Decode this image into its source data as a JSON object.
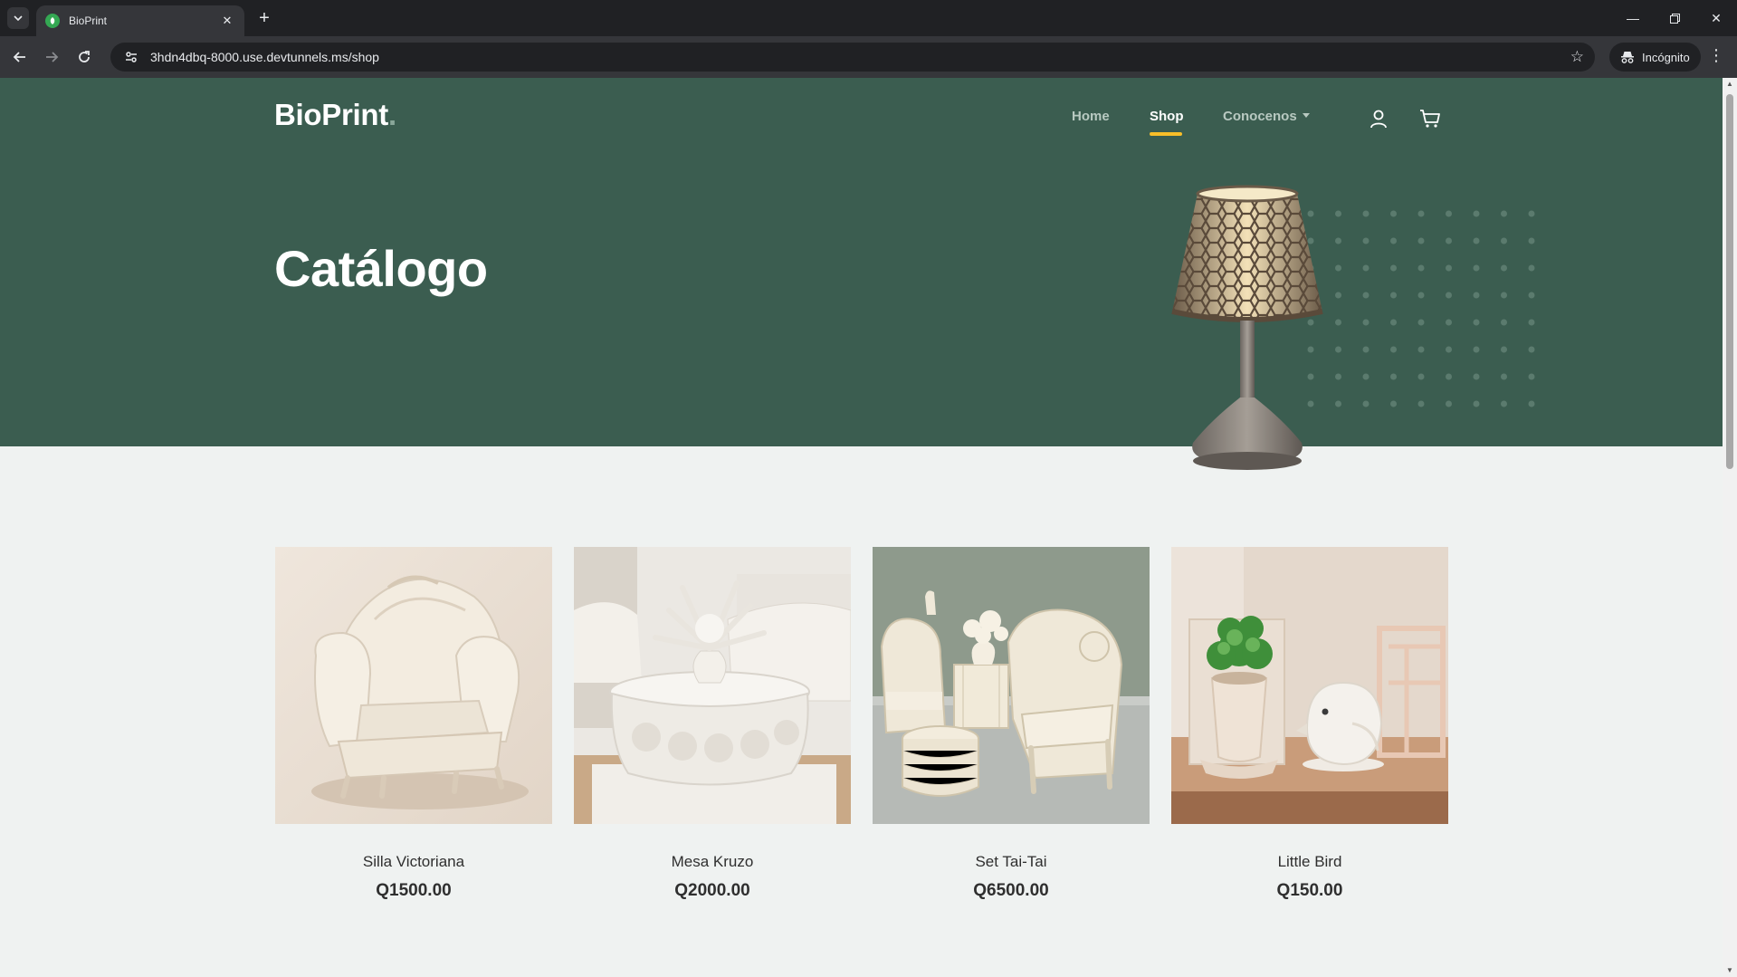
{
  "browser": {
    "tab_title": "BioPrint",
    "url": "3hdn4dbq-8000.use.devtunnels.ms/shop",
    "profile_label": "Incógnito"
  },
  "site": {
    "logo": "BioPrint",
    "logo_dot": ".",
    "nav": {
      "home": "Home",
      "shop": "Shop",
      "about": "Conocenos"
    },
    "hero_title": "Catálogo",
    "colors": {
      "hero_bg": "#3b5d50",
      "accent": "#f9bf29",
      "page_bg": "#eff2f1"
    }
  },
  "products": [
    {
      "name": "Silla Victoriana",
      "price": "Q1500.00"
    },
    {
      "name": "Mesa Kruzo",
      "price": "Q2000.00"
    },
    {
      "name": "Set Tai-Tai",
      "price": "Q6500.00"
    },
    {
      "name": "Little Bird",
      "price": "Q150.00"
    }
  ]
}
